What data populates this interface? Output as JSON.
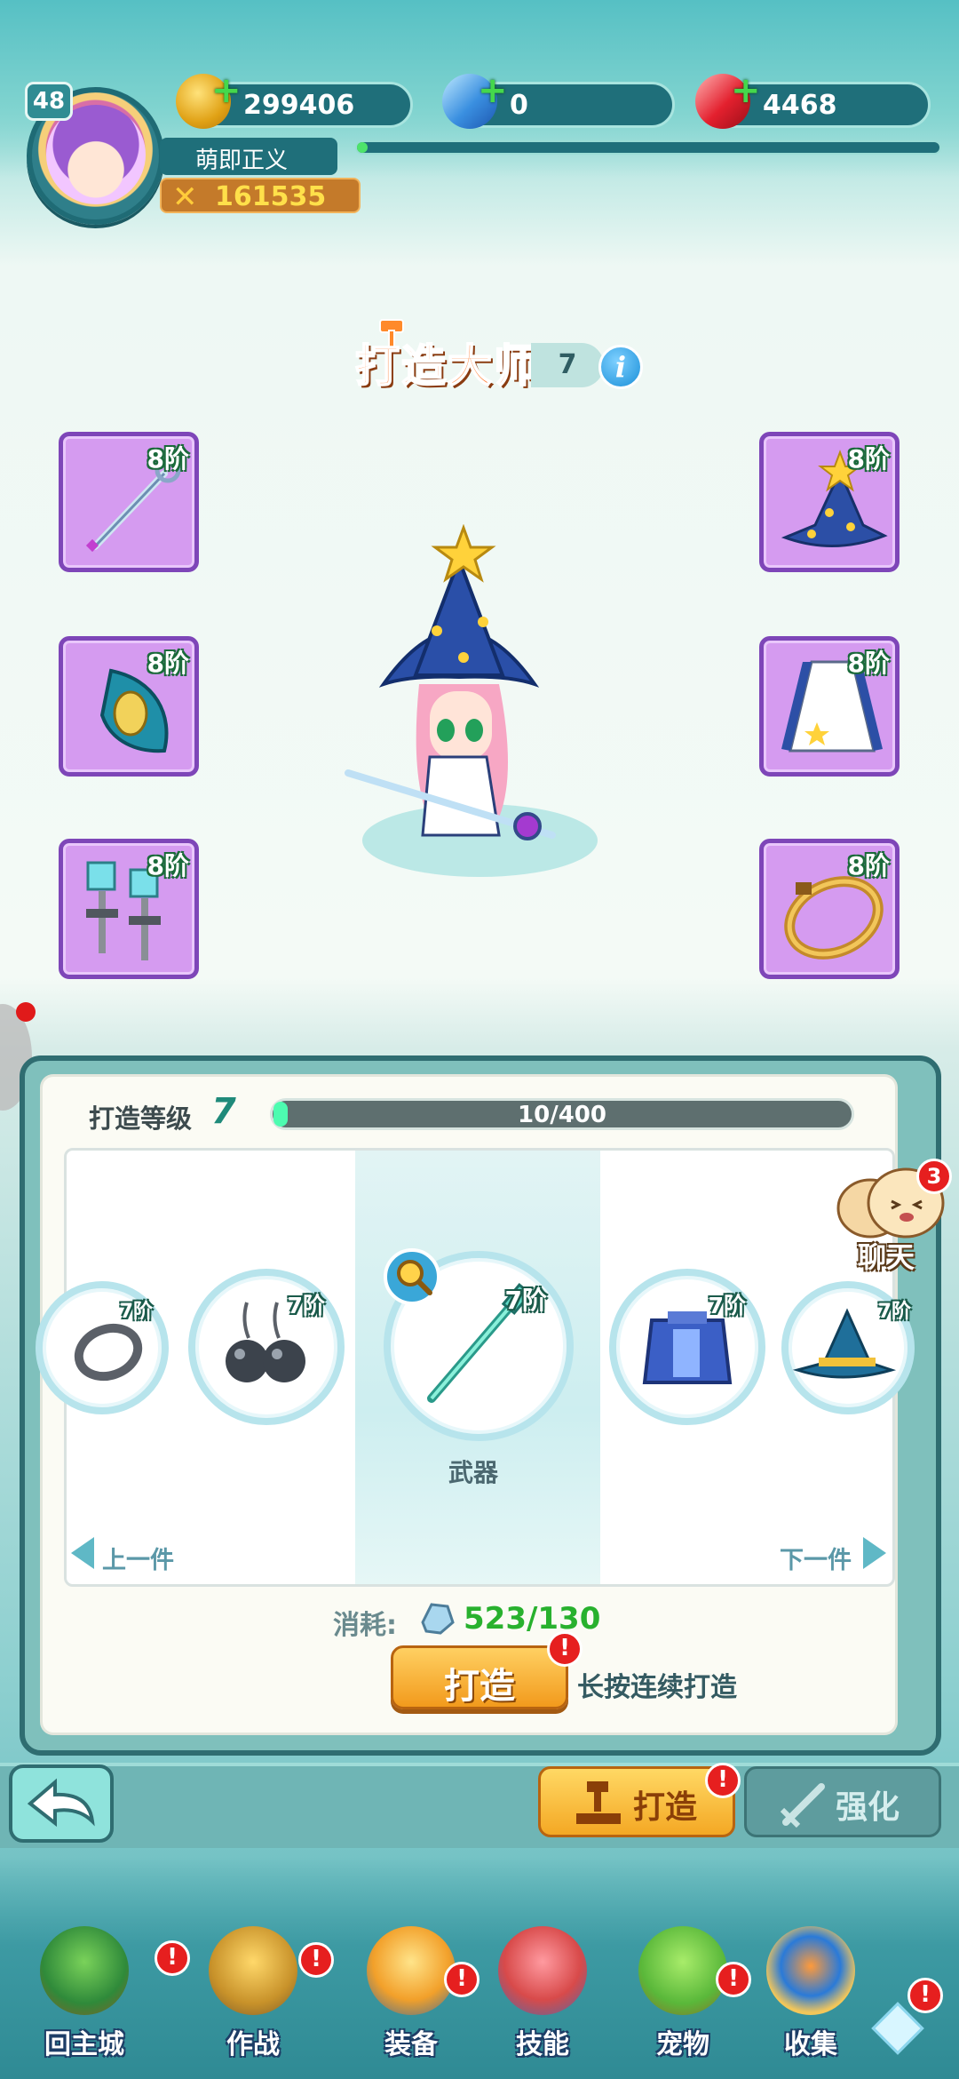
{
  "hud": {
    "level": "48",
    "gold": "299406",
    "diamond": "0",
    "ruby": "4468",
    "player_name": "萌即正义",
    "combat_power": "161535",
    "exp_fraction": 0.01
  },
  "title": {
    "text": "打造大师",
    "level": "7",
    "info": "i"
  },
  "slots": {
    "weapon_tier": "8阶",
    "hat_tier": "8阶",
    "shoulder_tier": "8阶",
    "robe_tier": "8阶",
    "earring_tier": "8阶",
    "ring_tier": "8阶"
  },
  "forge": {
    "level_label": "打造等级",
    "level": "7",
    "progress_text": "10/400",
    "progress_fraction": 0.025,
    "items": [
      {
        "name": "ring",
        "tier": "7阶"
      },
      {
        "name": "earrings",
        "tier": "7阶"
      },
      {
        "name": "weapon",
        "tier": "7阶"
      },
      {
        "name": "robe",
        "tier": "7阶"
      },
      {
        "name": "hat",
        "tier": "7阶"
      }
    ],
    "selected_label": "武器",
    "prev_label": "上一件",
    "next_label": "下一件",
    "cost_label": "消耗:",
    "cost_value": "523/130",
    "forge_button": "打造",
    "hold_label": "长按连续打造",
    "alert": "!"
  },
  "chat": {
    "label": "聊天",
    "badge": "3"
  },
  "action_bar": {
    "tab_forge": "打造",
    "tab_enhance": "强化"
  },
  "bottom_nav": [
    {
      "label": "回主城"
    },
    {
      "label": "作战"
    },
    {
      "label": "装备"
    },
    {
      "label": "技能"
    },
    {
      "label": "宠物"
    },
    {
      "label": "收集"
    }
  ],
  "colors": {
    "slot_bg": "#d59bf0",
    "accent_orange": "#f29a1c",
    "cost_green": "#28b12e"
  }
}
